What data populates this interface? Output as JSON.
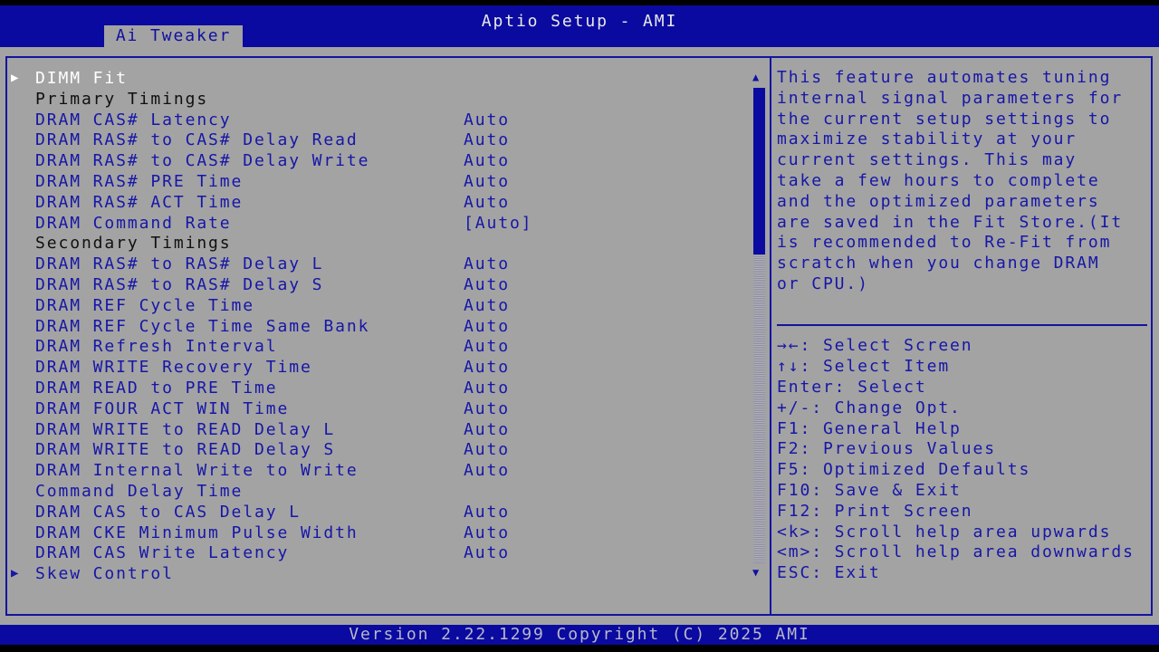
{
  "header": {
    "title": "Aptio Setup - AMI",
    "tab": "Ai Tweaker"
  },
  "menu": [
    {
      "label": "DIMM Fit",
      "type": "submenu",
      "selected": true
    },
    {
      "label": "Primary Timings",
      "type": "header"
    },
    {
      "label": "DRAM CAS# Latency",
      "value": "Auto"
    },
    {
      "label": "DRAM RAS# to CAS# Delay Read",
      "value": "Auto"
    },
    {
      "label": "DRAM RAS# to CAS# Delay Write",
      "value": "Auto"
    },
    {
      "label": "DRAM RAS# PRE Time",
      "value": "Auto"
    },
    {
      "label": "DRAM RAS# ACT Time",
      "value": "Auto"
    },
    {
      "label": "DRAM Command Rate",
      "value": "[Auto]"
    },
    {
      "label": "Secondary Timings",
      "type": "header"
    },
    {
      "label": "DRAM RAS# to RAS# Delay L",
      "value": "Auto"
    },
    {
      "label": "DRAM RAS# to RAS# Delay S",
      "value": "Auto"
    },
    {
      "label": "DRAM REF Cycle Time",
      "value": "Auto"
    },
    {
      "label": "DRAM REF Cycle Time Same Bank",
      "value": "Auto"
    },
    {
      "label": "DRAM Refresh Interval",
      "value": "Auto"
    },
    {
      "label": "DRAM WRITE Recovery Time",
      "value": "Auto"
    },
    {
      "label": "DRAM READ to PRE Time",
      "value": "Auto"
    },
    {
      "label": "DRAM FOUR ACT WIN Time",
      "value": "Auto"
    },
    {
      "label": "DRAM WRITE to READ Delay L",
      "value": "Auto"
    },
    {
      "label": "DRAM WRITE to READ Delay S",
      "value": "Auto"
    },
    {
      "label": "DRAM Internal Write to Write",
      "value": "Auto"
    },
    {
      "label": "Command Delay Time",
      "type": "cont"
    },
    {
      "label": "DRAM CAS to CAS Delay L",
      "value": "Auto"
    },
    {
      "label": "DRAM CKE Minimum Pulse Width",
      "value": "Auto"
    },
    {
      "label": "DRAM CAS Write Latency",
      "value": "Auto"
    },
    {
      "label": "Skew Control",
      "type": "submenu"
    }
  ],
  "help_text": [
    "This feature automates tuning",
    "internal signal parameters for",
    "the current setup settings to",
    "maximize stability at your",
    "current settings. This may",
    "take a few hours to complete",
    "and the optimized parameters",
    "are saved in the Fit Store.(It",
    "is recommended to Re-Fit from",
    "scratch when you change DRAM",
    "or CPU.)"
  ],
  "keys": [
    "→←: Select Screen",
    "↑↓: Select Item",
    "Enter: Select",
    "+/-: Change Opt.",
    "F1: General Help",
    "F2: Previous Values",
    "F5: Optimized Defaults",
    "F10: Save & Exit",
    "F12: Print Screen",
    "<k>: Scroll help area upwards",
    "<m>: Scroll help area downwards",
    "ESC: Exit"
  ],
  "scrollbar": {
    "position_fraction": 0.0,
    "visible_fraction": 0.35
  },
  "footer": "Version 2.22.1299 Copyright (C) 2025 AMI"
}
